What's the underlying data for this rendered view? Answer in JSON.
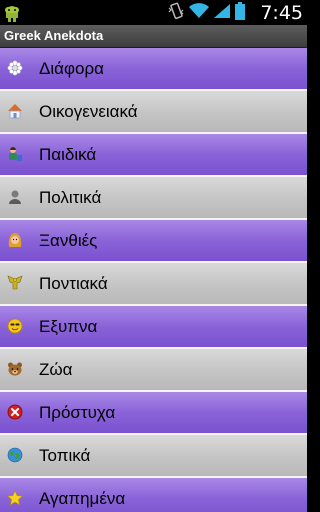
{
  "status_bar": {
    "time": "7:45",
    "icons": [
      "android-debug-icon",
      "vibrate-icon",
      "wifi-icon",
      "signal-icon",
      "battery-icon"
    ]
  },
  "app": {
    "title": "Greek Anekdota"
  },
  "list": {
    "items": [
      {
        "label": "Διάφορα",
        "icon": "gear-flower-icon",
        "style": "purple"
      },
      {
        "label": "Οικογενειακά",
        "icon": "house-icon",
        "style": "gray"
      },
      {
        "label": "Παιδικά",
        "icon": "child-icon",
        "style": "purple"
      },
      {
        "label": "Πολιτικά",
        "icon": "person-icon",
        "style": "gray"
      },
      {
        "label": "Ξανθιές",
        "icon": "blonde-icon",
        "style": "purple"
      },
      {
        "label": "Ποντιακά",
        "icon": "eagle-icon",
        "style": "gray"
      },
      {
        "label": "Εξυπνα",
        "icon": "smiley-icon",
        "style": "purple"
      },
      {
        "label": "Ζώα",
        "icon": "bear-icon",
        "style": "gray"
      },
      {
        "label": "Πρόστυχα",
        "icon": "x-mark-icon",
        "style": "purple"
      },
      {
        "label": "Τοπικά",
        "icon": "globe-icon",
        "style": "gray"
      },
      {
        "label": "Αγαπημένα",
        "icon": "star-icon",
        "style": "purple"
      }
    ]
  },
  "colors": {
    "purple_row": "#8a63d8",
    "gray_row": "#c6c6c6",
    "title_bar": "#4a4a4a"
  }
}
